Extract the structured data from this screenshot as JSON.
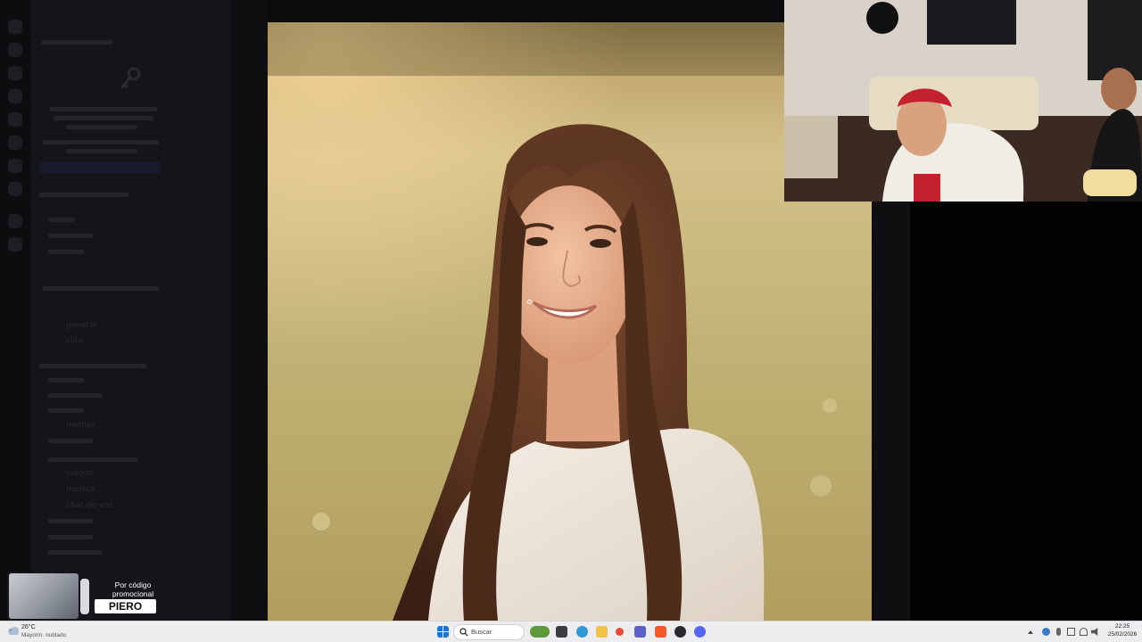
{
  "background_app": {
    "channels": [
      "general",
      "clips",
      "memes",
      "juegos",
      "música",
      "chat-de-voz"
    ]
  },
  "promo": {
    "label": "Por código promocional",
    "code": "PIERO"
  },
  "taskbar": {
    "weather_temp": "26°C",
    "weather_desc": "Mayorm. nublado",
    "search_placeholder": "Buscar",
    "clock_time": "22:25",
    "clock_date": "25/02/2026",
    "icons": [
      "windows-start-icon",
      "search-icon",
      "widgets-icon",
      "task-view-icon",
      "chrome-icon",
      "file-explorer-icon",
      "app-icon",
      "teams-icon",
      "brave-icon",
      "obs-icon",
      "discord-icon"
    ]
  },
  "colors": {
    "taskbar_bg": "#ededf0",
    "accent_discord": "#5865f2",
    "promo_code_bg": "#ffffff"
  }
}
